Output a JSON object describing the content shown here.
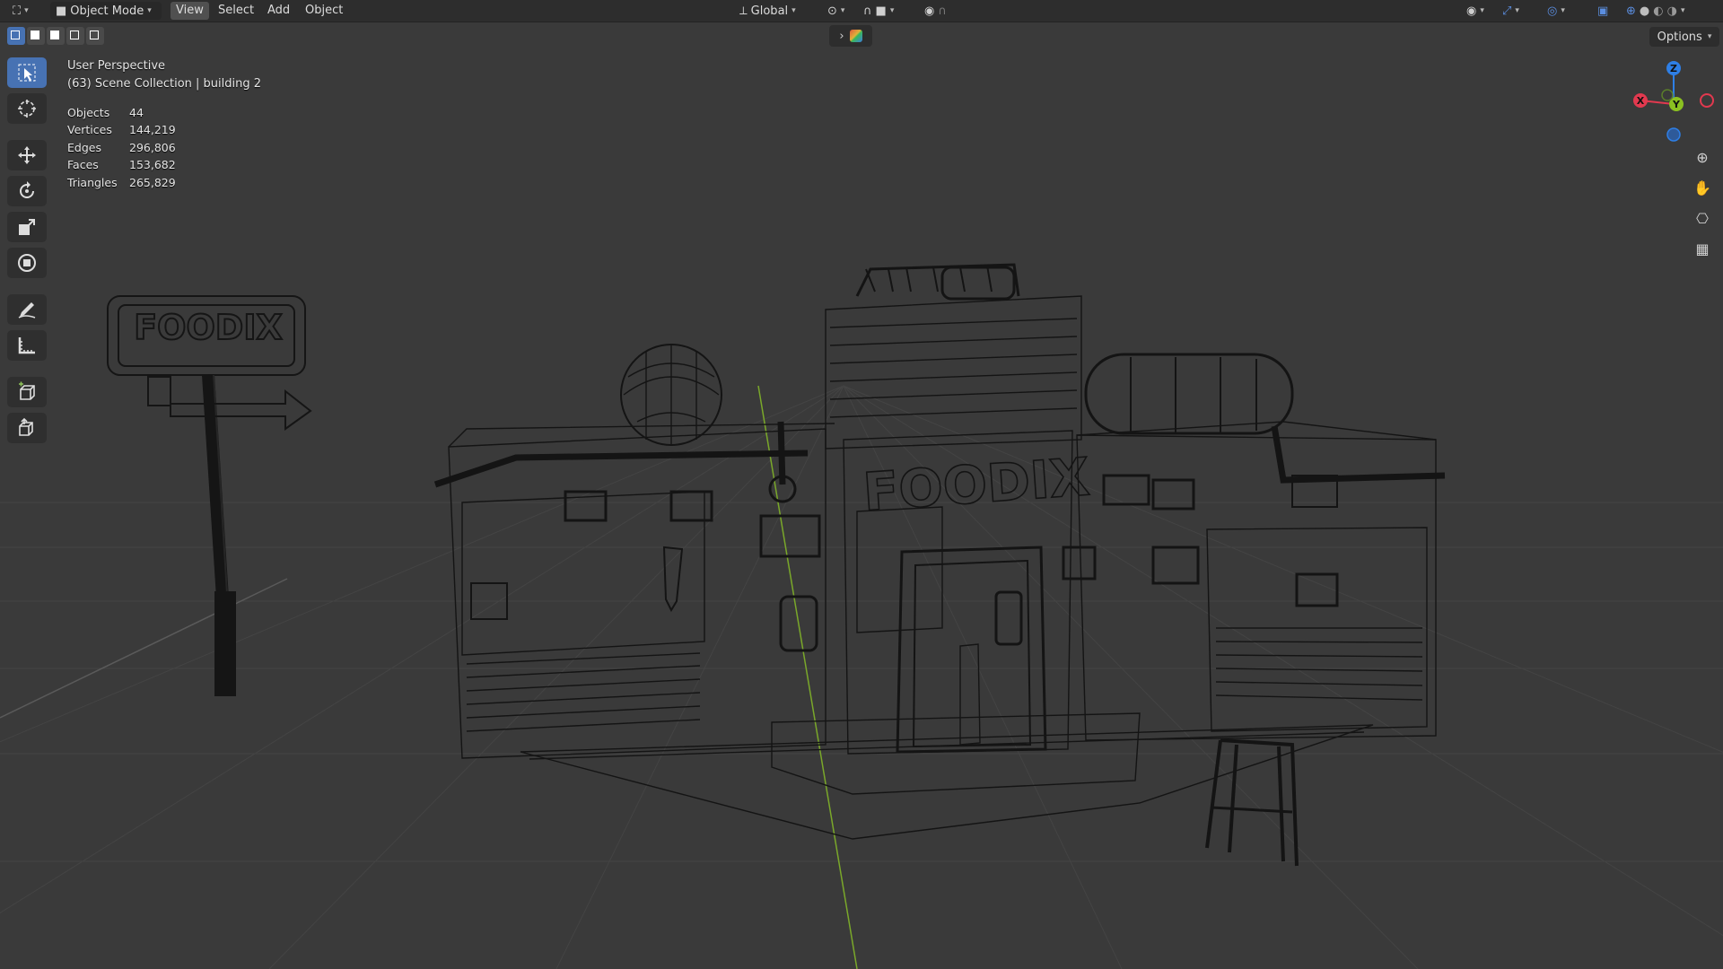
{
  "header": {
    "mode_label": "Object Mode",
    "menus": [
      "View",
      "Select",
      "Add",
      "Object"
    ],
    "transform_orientation": "Global",
    "options_label": "Options"
  },
  "viewport": {
    "view_name": "User Perspective",
    "collection_info": "(63) Scene Collection | building 2",
    "sign_text": "FOODIX",
    "stats": [
      {
        "label": "Objects",
        "value": "44"
      },
      {
        "label": "Vertices",
        "value": "144,219"
      },
      {
        "label": "Edges",
        "value": "296,806"
      },
      {
        "label": "Faces",
        "value": "153,682"
      },
      {
        "label": "Triangles",
        "value": "265,829"
      }
    ]
  },
  "gizmo": {
    "z_label": "Z",
    "y_label": "Y",
    "x_label": "X",
    "x_color": "#e2394f",
    "y_color": "#8bc121",
    "z_color": "#2e7fe6"
  },
  "toolbar": {
    "tools": [
      "select-box",
      "cursor",
      "move",
      "rotate",
      "scale",
      "transform",
      "annotate",
      "measure",
      "add-cube",
      "extrude"
    ]
  },
  "colors": {
    "active": "#4772b3",
    "background": "#3a3a3a",
    "wire": "#111111",
    "y_axis_line": "#7aa82a"
  }
}
